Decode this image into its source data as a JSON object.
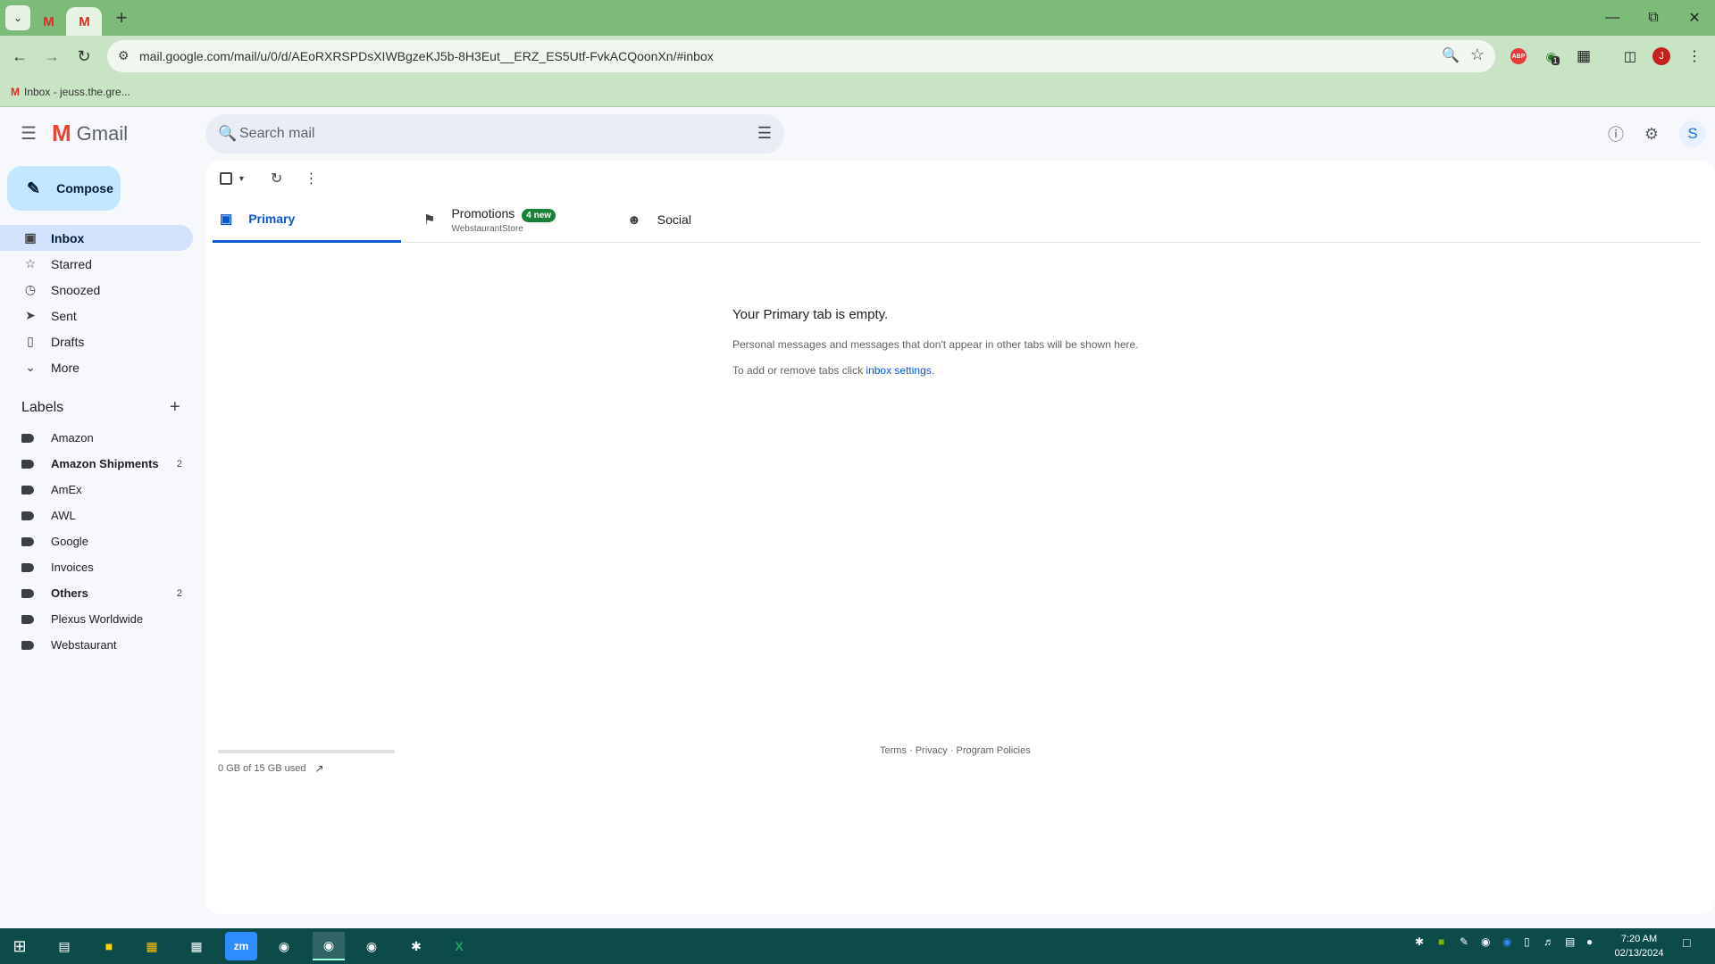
{
  "browser": {
    "tab_drop": "⌄",
    "tab1_favicon": "M",
    "tab2_favicon": "M",
    "newtab": "+",
    "url": "mail.google.com/mail/u/0/d/AEoRXRSPDsXIWBgzeKJ5b-8H3Eut__ERZ_ES5Utf-FvkACQoonXn/#inbox",
    "bookmark_label": "Inbox - jeuss.the.gre...",
    "profile_initial": "J",
    "extension_badge": "1"
  },
  "gmail": {
    "logo_text": "Gmail",
    "search_placeholder": "Search mail",
    "account_initial": "S",
    "compose_label": "Compose",
    "nav": [
      {
        "label": "Inbox"
      },
      {
        "label": "Starred"
      },
      {
        "label": "Snoozed"
      },
      {
        "label": "Sent"
      },
      {
        "label": "Drafts"
      },
      {
        "label": "More"
      }
    ],
    "labels_heading": "Labels",
    "labels": [
      {
        "name": "Amazon",
        "count": ""
      },
      {
        "name": "Amazon Shipments",
        "count": "2"
      },
      {
        "name": "AmEx",
        "count": ""
      },
      {
        "name": "AWL",
        "count": ""
      },
      {
        "name": "Google",
        "count": ""
      },
      {
        "name": "Invoices",
        "count": ""
      },
      {
        "name": "Others",
        "count": "2"
      },
      {
        "name": "Plexus Worldwide",
        "count": ""
      },
      {
        "name": "Webstaurant",
        "count": ""
      }
    ],
    "tabs": {
      "primary": "Primary",
      "promotions": "Promotions",
      "promotions_badge": "4 new",
      "promotions_sub": "WebstaurantStore",
      "social": "Social"
    },
    "empty": {
      "title": "Your Primary tab is empty.",
      "line1": "Personal messages and messages that don't appear in other tabs will be shown here.",
      "line2_prefix": "To add or remove tabs click ",
      "line2_link": "inbox settings",
      "line2_suffix": "."
    },
    "storage": {
      "text": "0 GB of 15 GB used",
      "used_fraction": 0
    },
    "footer": "Terms · Privacy · Program Policies"
  },
  "taskbar": {
    "time": "7:20 AM",
    "date": "02/13/2024",
    "zoom_label": "zm"
  },
  "colors": {
    "browser_frame": "#7cbb78",
    "gmail_accent": "#0b57d0",
    "compose_bg": "#c2e7ff",
    "promo_badge": "#188038",
    "taskbar": "#0d4a4a"
  }
}
